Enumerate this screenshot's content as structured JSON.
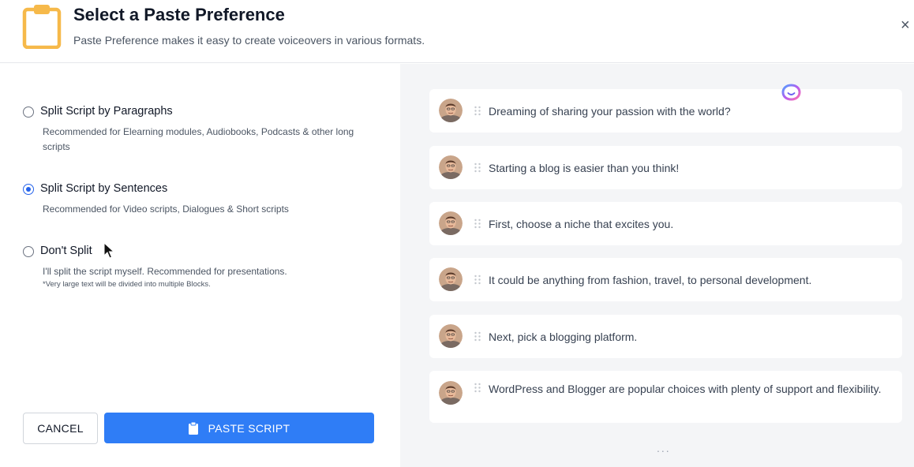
{
  "header": {
    "title": "Select a Paste Preference",
    "subtitle": "Paste Preference makes it easy to create voiceovers in various formats.",
    "icon": "clipboard-icon",
    "close_label": "×"
  },
  "options": [
    {
      "label": "Split Script by Paragraphs",
      "description": "Recommended for Elearning modules, Audiobooks, Podcasts & other long scripts",
      "selected": false
    },
    {
      "label": "Split Script by Sentences",
      "description": "Recommended for Video scripts, Dialogues & Short scripts",
      "selected": true
    },
    {
      "label": "Don't Split",
      "description": "I'll split the script myself. Recommended for presentations.",
      "note": "*Very large text will be divided into multiple Blocks.",
      "selected": false
    }
  ],
  "buttons": {
    "cancel": "CANCEL",
    "paste": "PASTE SCRIPT"
  },
  "preview": {
    "blocks": [
      "Dreaming of sharing your passion with the world?",
      "Starting a blog is easier than you think!",
      "First, choose a niche that excites you.",
      "It could be anything from fashion, travel, to personal development.",
      "Next, pick a blogging platform.",
      "WordPress and Blogger are popular choices with plenty of support and flexibility."
    ],
    "more": "..."
  },
  "colors": {
    "accent": "#2f7df6",
    "header_icon": "#f6b94a",
    "preview_background": "#f4f5f7"
  }
}
